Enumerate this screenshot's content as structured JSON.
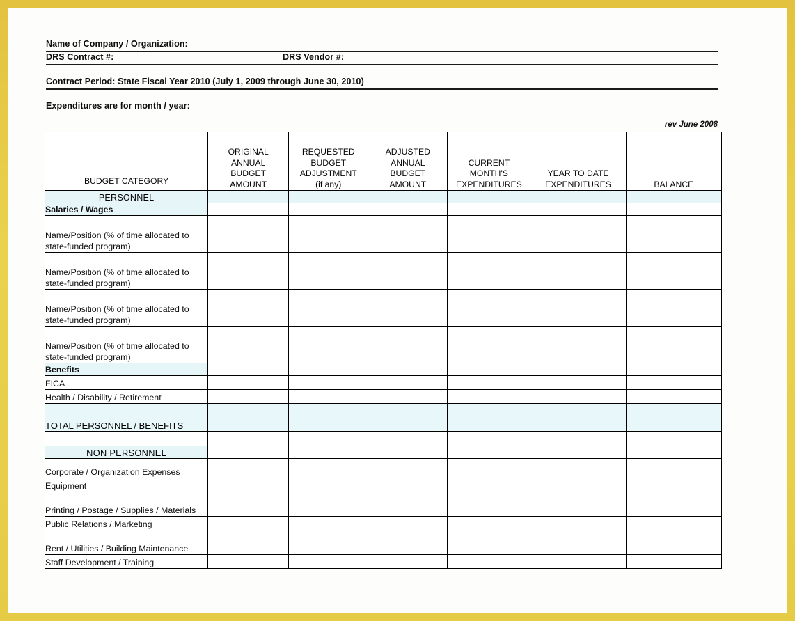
{
  "document": {
    "form_fields": [
      {
        "label": "Name of Company / Organization:",
        "second_label": null
      },
      {
        "label": "DRS Contract #:",
        "second_label": "DRS Vendor #:"
      }
    ],
    "contract_period": "Contract Period: State Fiscal Year 2010 (July 1, 2009 through June 30, 2010)",
    "expenditures_line": "Expenditures are for month / year:",
    "revision_note": "rev June 2008",
    "watermark": ""
  },
  "table": {
    "columns": [
      {
        "lines": [
          "BUDGET CATEGORY"
        ]
      },
      {
        "lines": [
          "ORIGINAL",
          "ANNUAL",
          "BUDGET",
          "AMOUNT"
        ]
      },
      {
        "lines": [
          "REQUESTED",
          "BUDGET",
          "ADJUSTMENT",
          "(if any)"
        ]
      },
      {
        "lines": [
          "ADJUSTED",
          "ANNUAL",
          "BUDGET",
          "AMOUNT"
        ]
      },
      {
        "lines": [
          "CURRENT",
          "MONTH'S",
          "EXPENDITURES"
        ]
      },
      {
        "lines": [
          "YEAR TO DATE",
          "EXPENDITURES"
        ]
      },
      {
        "lines": [
          "BALANCE"
        ]
      }
    ],
    "rows": [
      {
        "label": "PERSONNEL",
        "style": "section-center"
      },
      {
        "label": "Salaries / Wages",
        "style": "section-left"
      },
      {
        "label": "Name/Position (% of time allocated to state-funded program)",
        "style": "name"
      },
      {
        "label": "Name/Position (% of time allocated to state-funded program)",
        "style": "name"
      },
      {
        "label": "Name/Position (% of time allocated to state-funded program)",
        "style": "name"
      },
      {
        "label": "Name/Position (% of time allocated to state-funded program)",
        "style": "name"
      },
      {
        "label": "Benefits",
        "style": "section-left"
      },
      {
        "label": "FICA",
        "style": "item"
      },
      {
        "label": "Health / Disability / Retirement",
        "style": "item"
      },
      {
        "label": "TOTAL PERSONNEL / BENEFITS",
        "style": "total"
      },
      {
        "label": "",
        "style": "blank"
      },
      {
        "label": "NON PERSONNEL",
        "style": "section-center"
      },
      {
        "label": "Corporate / Organization Expenses",
        "style": "item-tall"
      },
      {
        "label": "Equipment",
        "style": "item"
      },
      {
        "label": "Printing / Postage / Supplies / Materials",
        "style": "item-two"
      },
      {
        "label": "Public Relations / Marketing",
        "style": "item"
      },
      {
        "label": "Rent / Utilities / Building Maintenance",
        "style": "item-two"
      },
      {
        "label": "Staff Development / Training",
        "style": "item"
      }
    ]
  },
  "colors": {
    "page_frame": "#e9c84a",
    "header_fill": "#f1faee",
    "band_fill": "#e6f5f8",
    "border": "#000000"
  }
}
